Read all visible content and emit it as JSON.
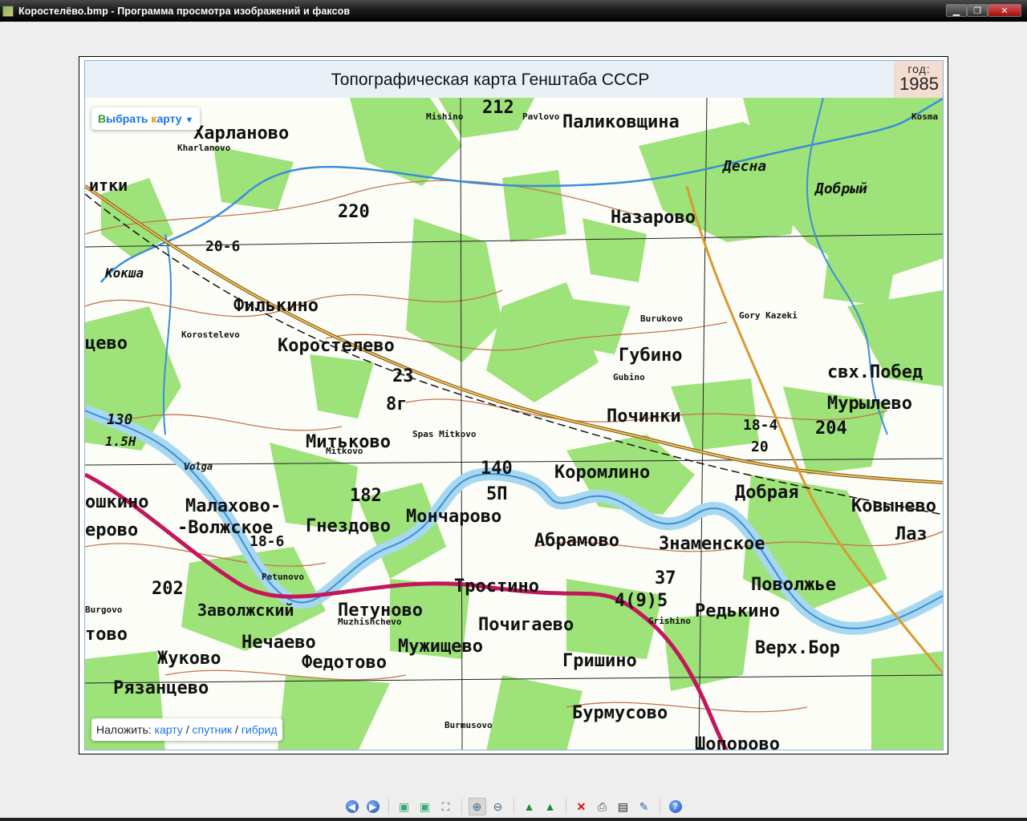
{
  "window": {
    "title": "Коростелёво.bmp - Программа просмотра изображений и факсов",
    "buttons": [
      "minimize",
      "restore",
      "close"
    ]
  },
  "map": {
    "title": "Топографическая карта Генштаба СССР",
    "year_label": "год:",
    "year": "1985",
    "choose_map": {
      "part1": "В",
      "part2": "ыбрать ",
      "part3": "к",
      "part4": "арту",
      "colors": [
        "#2e9e2e",
        "#1a73e8",
        "#f08c00",
        "#1a73e8"
      ]
    },
    "overlay": {
      "label": "Наложить:",
      "options": [
        "карту",
        "спутник",
        "гибрид"
      ],
      "separator": "/"
    },
    "labels": [
      "Харланово",
      "Kharlanovo",
      "Mishino",
      "212",
      "Pavlovo",
      "Паликовщина",
      "Kosma",
      "Десна",
      "Назарово",
      "220",
      "20-6",
      "Кокша",
      "Филькино",
      "Korostelevo",
      "Коростелево",
      "Burukovo",
      "Gory Kazeki",
      "Губино",
      "Gubino",
      "свх.Побед",
      "Мурылево",
      "23",
      "8г",
      "Починки",
      "18-4",
      "20",
      "204",
      "Митьково",
      "Spas Mitkovo",
      "Mitkovo",
      "130",
      "1.5Н",
      "140",
      "5П",
      "Коромлино",
      "Добрая",
      "Ковынево",
      "Малахово-",
      "-Волжское",
      "182",
      "Гнездово",
      "Мончарово",
      "Абрамово",
      "Знаменское",
      "Лаз",
      "ошкино",
      "ерово",
      "18-6",
      "Petunovo",
      "202",
      "Тростино",
      "Поволжье",
      "37",
      "4(9)5",
      "Burgovo",
      "Заволжский",
      "Петуново",
      "Почигаево",
      "Muzhishchevo",
      "Редькино",
      "Grishino",
      "Верх.Бор",
      "Нечаево",
      "Мужищево",
      "Жуково",
      "Федотово",
      "Гришино",
      "Рязанцево",
      "Бурмусово",
      "Burmusovo",
      "Шопорово",
      "Volga",
      "итки",
      "цево",
      "тово",
      "Добрый"
    ]
  },
  "toolbar": {
    "buttons": [
      "previous",
      "next",
      "best-fit",
      "actual-size",
      "slideshow",
      "zoom-in",
      "zoom-out",
      "rotate-clockwise",
      "rotate-counterclockwise",
      "delete",
      "print",
      "save",
      "edit",
      "help"
    ]
  }
}
